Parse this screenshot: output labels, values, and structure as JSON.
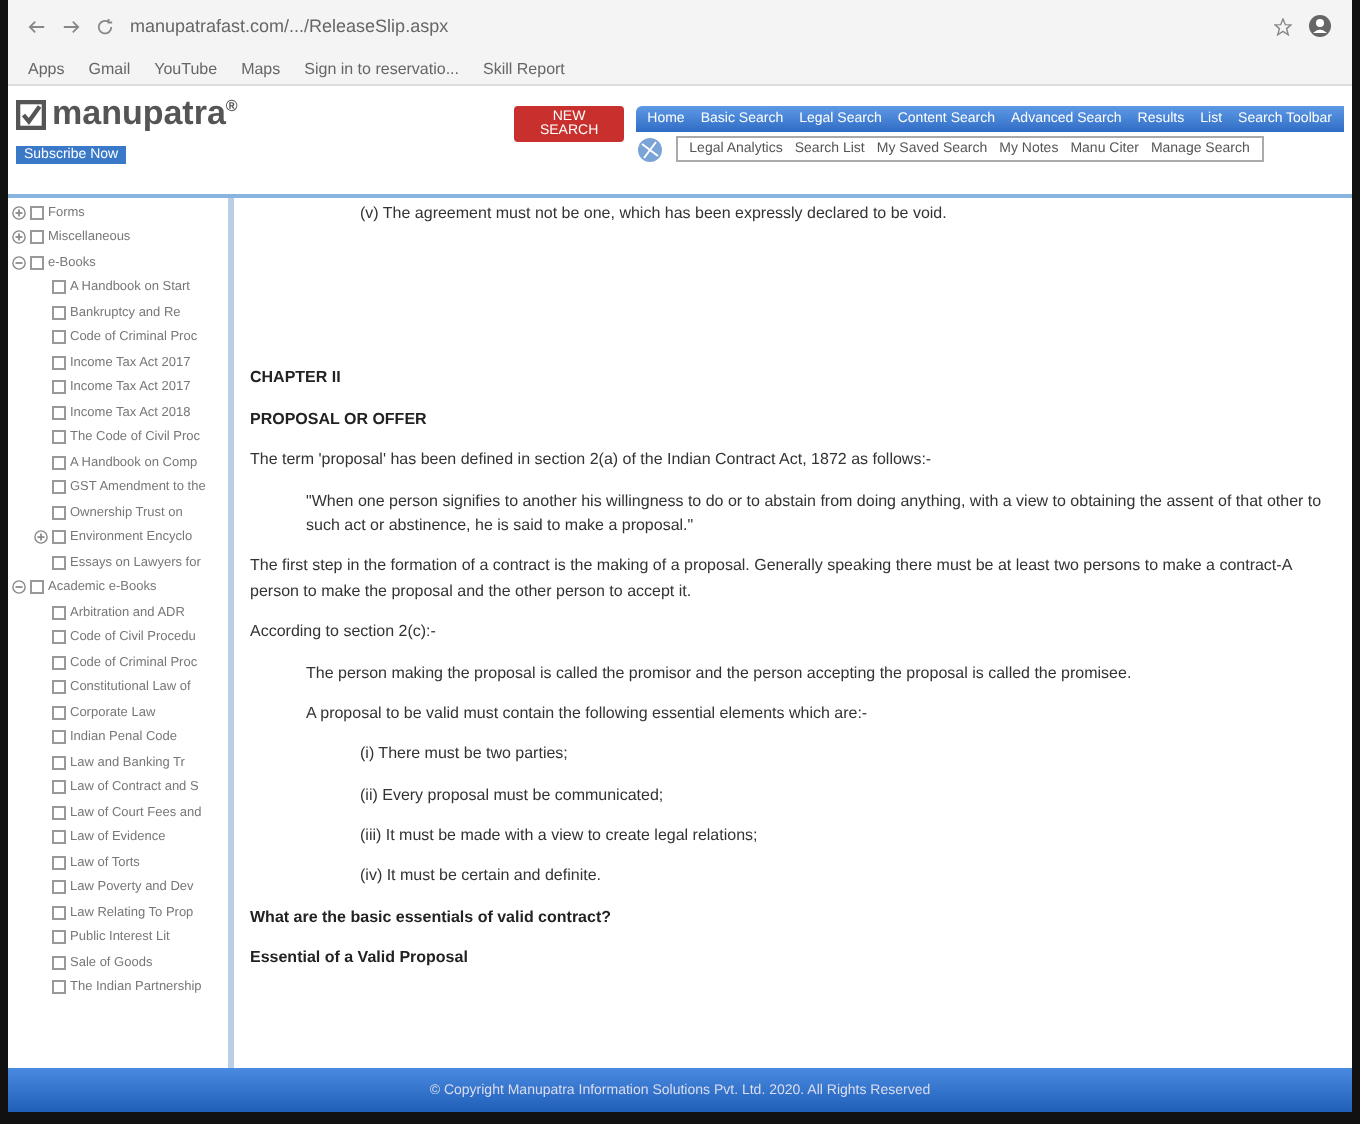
{
  "browser": {
    "url": "manupatrafast.com/.../ReleaseSlip.aspx",
    "bookmarks": [
      {
        "label": "Apps"
      },
      {
        "label": "Gmail"
      },
      {
        "label": "YouTube"
      },
      {
        "label": "Maps"
      },
      {
        "label": "Sign in to reservatio..."
      },
      {
        "label": "Skill Report"
      }
    ]
  },
  "header": {
    "logo": "manupatra",
    "logo_mark": "®",
    "sub_button": "Subscribe Now",
    "red_button": "NEW SEARCH",
    "nav": [
      "Home",
      "Basic Search",
      "Legal Search",
      "Content Search",
      "Advanced Search",
      "Results",
      "List",
      "Search Toolbar"
    ],
    "subnav": [
      "Legal Analytics",
      "Search List",
      "My Saved Search",
      "My Notes",
      "Manu Citer",
      "Manage Search"
    ]
  },
  "sidebar": {
    "items": [
      {
        "label": "Forms",
        "expanded": false,
        "checked": false
      },
      {
        "label": "Miscellaneous",
        "expanded": false,
        "checked": false
      },
      {
        "label": "e-Books",
        "expanded": true,
        "checked": false,
        "children": [
          {
            "label": "A Handbook on Start",
            "checked": false
          },
          {
            "label": "Bankruptcy and Re",
            "checked": false
          },
          {
            "label": "Code of Criminal Proc",
            "checked": false
          },
          {
            "label": "Income Tax Act 2017",
            "checked": false
          },
          {
            "label": "Income Tax Act 2017",
            "checked": false
          },
          {
            "label": "Income Tax Act 2018",
            "checked": false
          },
          {
            "label": "The Code of Civil Proc",
            "checked": false
          },
          {
            "label": "A Handbook on Comp",
            "checked": false
          },
          {
            "label": "GST Amendment to the",
            "checked": false
          },
          {
            "label": "Ownership Trust on",
            "checked": false
          },
          {
            "label": "Environment Encyclo",
            "checked": false,
            "expandable": true
          },
          {
            "label": "Essays on Lawyers for",
            "checked": false
          }
        ]
      },
      {
        "label": "Academic e-Books",
        "expanded": true,
        "checked": false,
        "children": [
          {
            "label": "Arbitration and ADR",
            "checked": false
          },
          {
            "label": "Code of Civil Procedu",
            "checked": false
          },
          {
            "label": "Code of Criminal Proc",
            "checked": false
          },
          {
            "label": "Constitutional Law of",
            "checked": false
          },
          {
            "label": "Corporate Law",
            "checked": false
          },
          {
            "label": "Indian Penal Code",
            "checked": false
          },
          {
            "label": "Law and Banking Tr",
            "checked": false
          },
          {
            "label": "Law of Contract and S",
            "checked": false
          },
          {
            "label": "Law of Court Fees and",
            "checked": false
          },
          {
            "label": "Law of Evidence",
            "checked": false
          },
          {
            "label": "Law of Torts",
            "checked": false
          },
          {
            "label": "Law Poverty and Dev",
            "checked": false
          },
          {
            "label": "Law Relating To Prop",
            "checked": false
          },
          {
            "label": "Public Interest Lit",
            "checked": false
          },
          {
            "label": "Sale of Goods",
            "checked": false
          },
          {
            "label": "The Indian Partnership",
            "checked": false
          }
        ]
      }
    ]
  },
  "content": {
    "blocks": [
      {
        "kind": "item",
        "text": "(v) The agreement must not be one, which has been expressly declared to be void."
      },
      {
        "kind": "spacer"
      },
      {
        "kind": "heading",
        "text": "CHAPTER II"
      },
      {
        "kind": "heading",
        "text": "PROPOSAL OR OFFER"
      },
      {
        "kind": "para",
        "text": "The term 'proposal' has been defined in section 2(a) of the Indian Contract Act, 1872 as follows:-"
      },
      {
        "kind": "quote",
        "text": "\"When one person signifies to another his willingness to do or to abstain from doing anything, with a view to obtaining the assent of that other to such act or abstinence, he is said to make a proposal.\""
      },
      {
        "kind": "para",
        "text": "The first step in the formation of a contract is the making of a proposal. Generally speaking there must be at least two persons to make a contract-A person to make the proposal and the other person to accept it."
      },
      {
        "kind": "para",
        "text": "According to section 2(c):-"
      },
      {
        "kind": "quote",
        "text": "The person making the proposal is called the promisor and the person accepting the proposal is called the promisee."
      },
      {
        "kind": "quote",
        "text": "A proposal to be valid must contain the following essential elements which are:-"
      },
      {
        "kind": "item",
        "text": "(i) There must be two parties;"
      },
      {
        "kind": "item",
        "text": "(ii) Every proposal must be communicated;"
      },
      {
        "kind": "item",
        "text": "(iii) It must be made with a view to create legal relations;"
      },
      {
        "kind": "item",
        "text": "(iv) It must be certain and definite."
      },
      {
        "kind": "heading",
        "text": "What are the basic essentials of valid contract?"
      },
      {
        "kind": "heading",
        "text": "Essential of a Valid Proposal"
      }
    ]
  },
  "footer": "© Copyright Manupatra Information Solutions Pvt. Ltd. 2020. All Rights Reserved"
}
